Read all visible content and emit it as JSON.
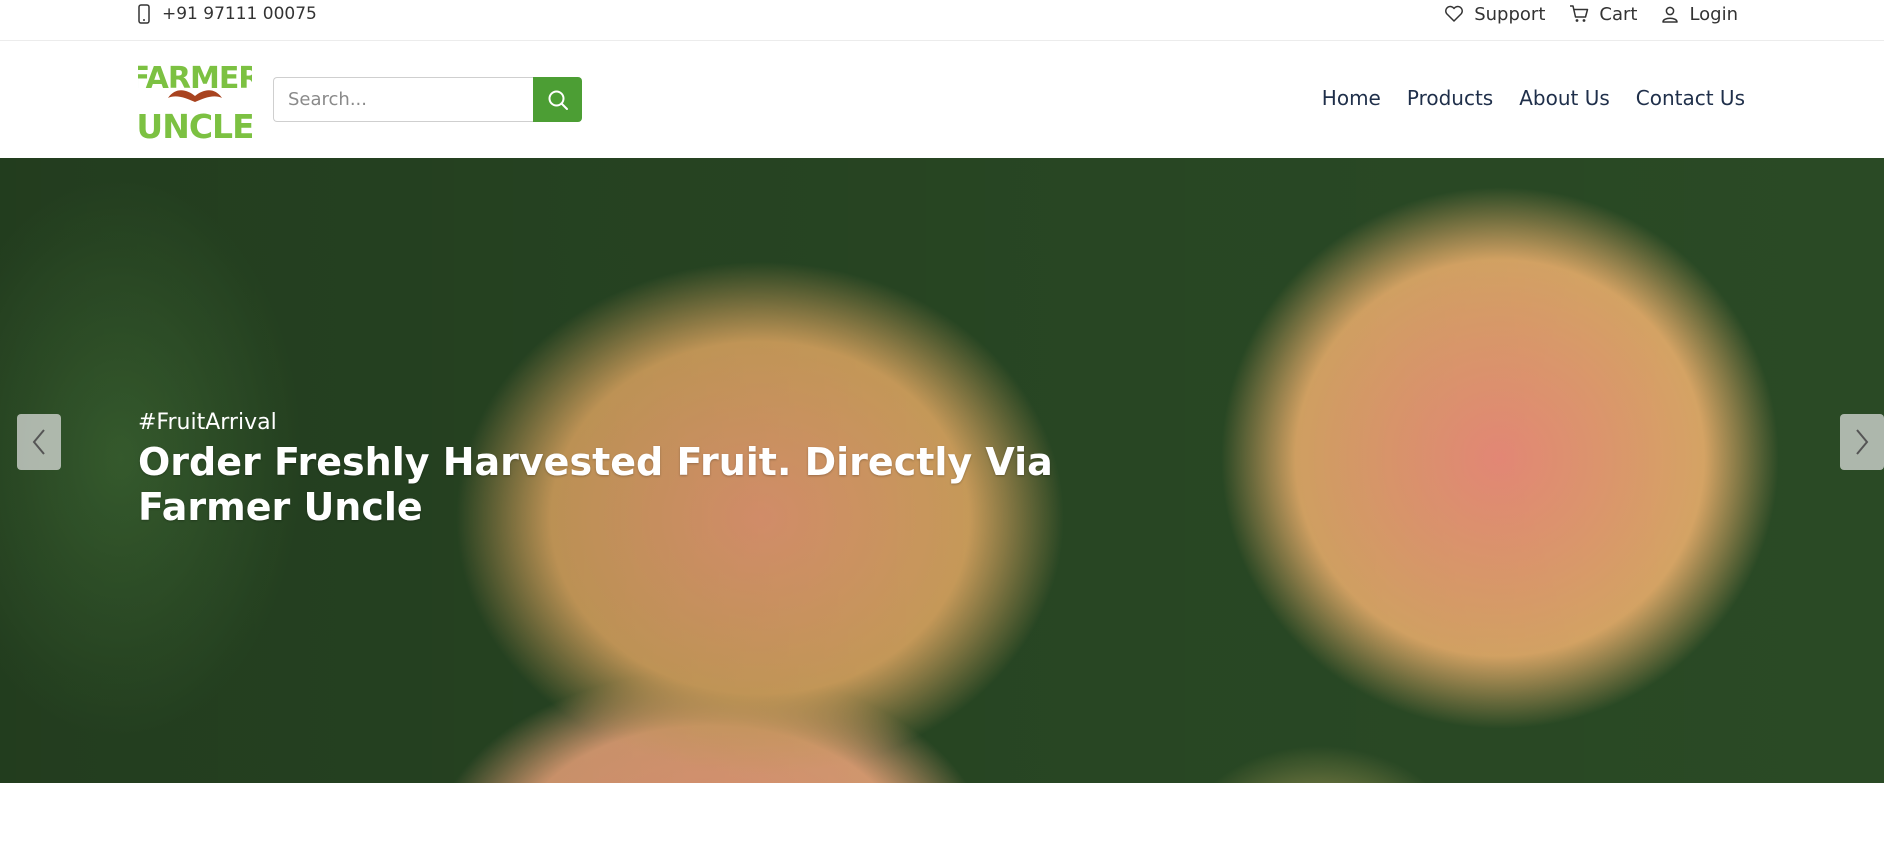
{
  "topbar": {
    "phone": "+91 97111 00075",
    "support_label": "Support",
    "cart_label": "Cart",
    "login_label": "Login"
  },
  "header": {
    "logo_alt": "FARMER UNCLE",
    "logo_line1": "FARMER",
    "logo_line2": "UNCLE",
    "search_placeholder": "Search...",
    "nav": [
      "Home",
      "Products",
      "About Us",
      "Contact Us"
    ]
  },
  "hero": {
    "tag": "#FruitArrival",
    "headline": "Order Freshly Harvested Fruit. Directly Via Farmer Uncle"
  },
  "icons": {
    "phone": "mobile-phone-icon",
    "support": "heart-icon",
    "cart": "cart-icon",
    "login": "user-icon",
    "search": "search-icon",
    "prev": "chevron-left-icon",
    "next": "chevron-right-icon"
  },
  "colors": {
    "brand_green": "#4c9e34",
    "logo_green": "#7cc142",
    "logo_mustache": "#a8431f",
    "nav_text": "#1f2f4a"
  }
}
